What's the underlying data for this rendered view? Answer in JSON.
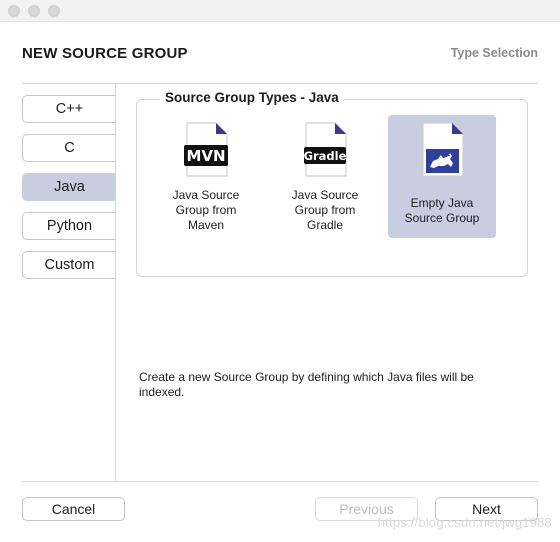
{
  "window": {
    "title": "NEW SOURCE GROUP",
    "step": "Type Selection"
  },
  "sidebar": {
    "items": [
      {
        "label": "C++",
        "selected": false
      },
      {
        "label": "C",
        "selected": false
      },
      {
        "label": "Java",
        "selected": true
      },
      {
        "label": "Python",
        "selected": false
      },
      {
        "label": "Custom",
        "selected": false
      }
    ]
  },
  "group": {
    "title": "Source Group Types - Java",
    "types": [
      {
        "icon": "maven-icon",
        "badge": "MVN",
        "label_lines": [
          "Java Source",
          "Group from",
          "Maven"
        ],
        "selected": false
      },
      {
        "icon": "gradle-icon",
        "badge": "Gradle",
        "label_lines": [
          "Java Source",
          "Group from",
          "Gradle"
        ],
        "selected": false
      },
      {
        "icon": "empty-java-icon",
        "badge": "",
        "label_lines": [
          "Empty Java",
          "Source Group"
        ],
        "selected": true
      }
    ]
  },
  "description": "Create a new Source Group by defining which Java files will be indexed.",
  "footer": {
    "cancel_label": "Cancel",
    "previous_label": "Previous",
    "next_label": "Next"
  },
  "watermark": "https://blog.csdn.net/jwg1988",
  "colors": {
    "selection": "#c9cde0",
    "badge_dark": "#111111",
    "java_icon_blue": "#2f3f9a",
    "fold_purple": "#3a3a8c"
  }
}
